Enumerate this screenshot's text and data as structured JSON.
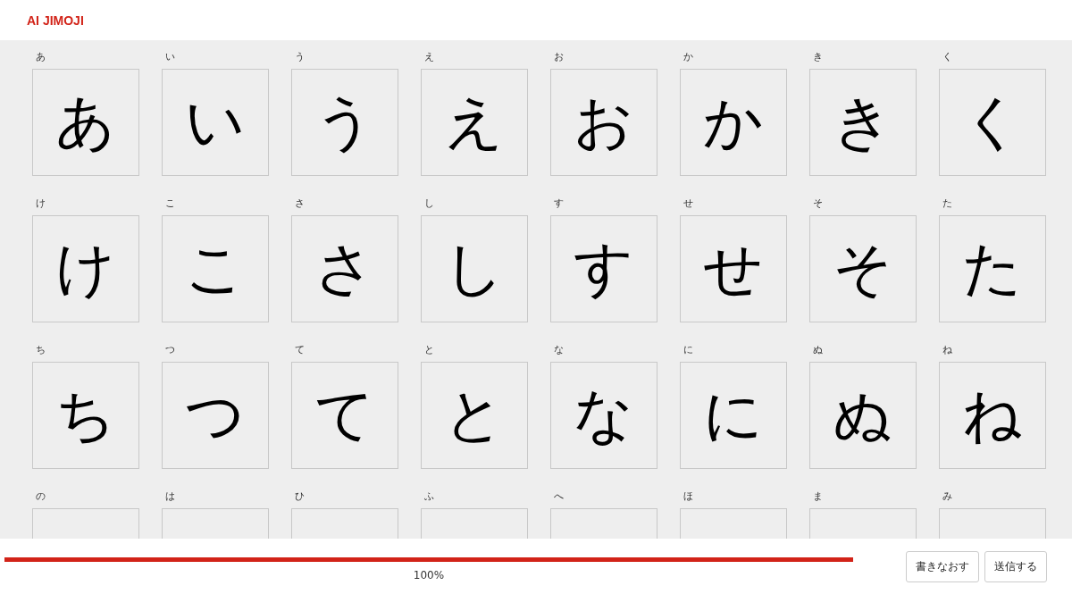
{
  "header": {
    "title": "AI JIMOJI"
  },
  "cells": [
    {
      "label": "あ",
      "drawing": "あ"
    },
    {
      "label": "い",
      "drawing": "い"
    },
    {
      "label": "う",
      "drawing": "う"
    },
    {
      "label": "え",
      "drawing": "え"
    },
    {
      "label": "お",
      "drawing": "お"
    },
    {
      "label": "か",
      "drawing": "か"
    },
    {
      "label": "き",
      "drawing": "き"
    },
    {
      "label": "く",
      "drawing": "く"
    },
    {
      "label": "け",
      "drawing": "け"
    },
    {
      "label": "こ",
      "drawing": "こ"
    },
    {
      "label": "さ",
      "drawing": "さ"
    },
    {
      "label": "し",
      "drawing": "し"
    },
    {
      "label": "す",
      "drawing": "す"
    },
    {
      "label": "せ",
      "drawing": "せ"
    },
    {
      "label": "そ",
      "drawing": "そ"
    },
    {
      "label": "た",
      "drawing": "た"
    },
    {
      "label": "ち",
      "drawing": "ち"
    },
    {
      "label": "つ",
      "drawing": "つ"
    },
    {
      "label": "て",
      "drawing": "て"
    },
    {
      "label": "と",
      "drawing": "と"
    },
    {
      "label": "な",
      "drawing": "な"
    },
    {
      "label": "に",
      "drawing": "に"
    },
    {
      "label": "ぬ",
      "drawing": "ぬ"
    },
    {
      "label": "ね",
      "drawing": "ね"
    },
    {
      "label": "の"
    },
    {
      "label": "は"
    },
    {
      "label": "ひ"
    },
    {
      "label": "ふ"
    },
    {
      "label": "へ"
    },
    {
      "label": "ほ"
    },
    {
      "label": "ま"
    },
    {
      "label": "み"
    }
  ],
  "progress": {
    "level": 1,
    "reading": "100%"
  },
  "buttons": [
    "書きなおす",
    "送信する"
  ]
}
